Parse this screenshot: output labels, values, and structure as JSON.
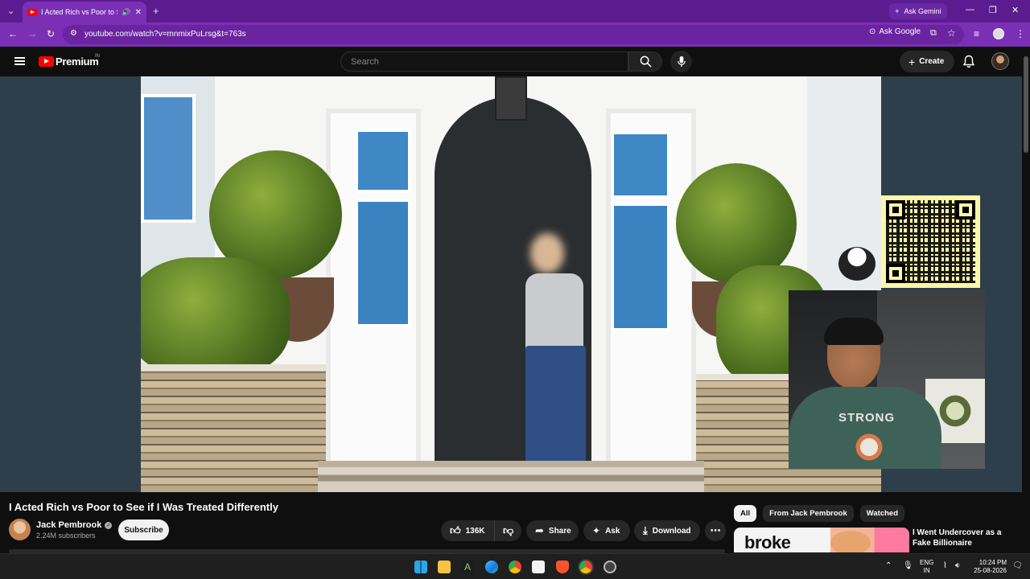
{
  "browser": {
    "tab_title": "I Acted Rich vs Poor to See",
    "url": "youtube.com/watch?v=mnmixPuLrsg&t=763s",
    "ask_gemini": "Ask Gemini",
    "ask_google": "Ask Google",
    "accent": "#7b2fb5"
  },
  "header": {
    "logo_text": "Premium",
    "region": "IN",
    "search_placeholder": "Search",
    "create_label": "Create"
  },
  "video": {
    "title": "I Acted Rich vs Poor to See if I Was Treated Differently",
    "channel": "Jack Pembrook",
    "subscribers": "2.24M subscribers",
    "subscribe_label": "Subscribe",
    "likes": "136K",
    "share_label": "Share",
    "ask_label": "Ask",
    "download_label": "Download",
    "webcam_shirt_text": "STRONG"
  },
  "sidebar": {
    "chips": [
      "All",
      "From Jack Pembrook",
      "Watched"
    ],
    "recommended": {
      "thumb_text": "broke",
      "title": "I Went Undercover as a Fake Billionaire"
    }
  },
  "taskbar": {
    "lang_line1": "ENG",
    "lang_line2": "IN",
    "time": "10:24 PM",
    "date": "25-08-2026"
  }
}
